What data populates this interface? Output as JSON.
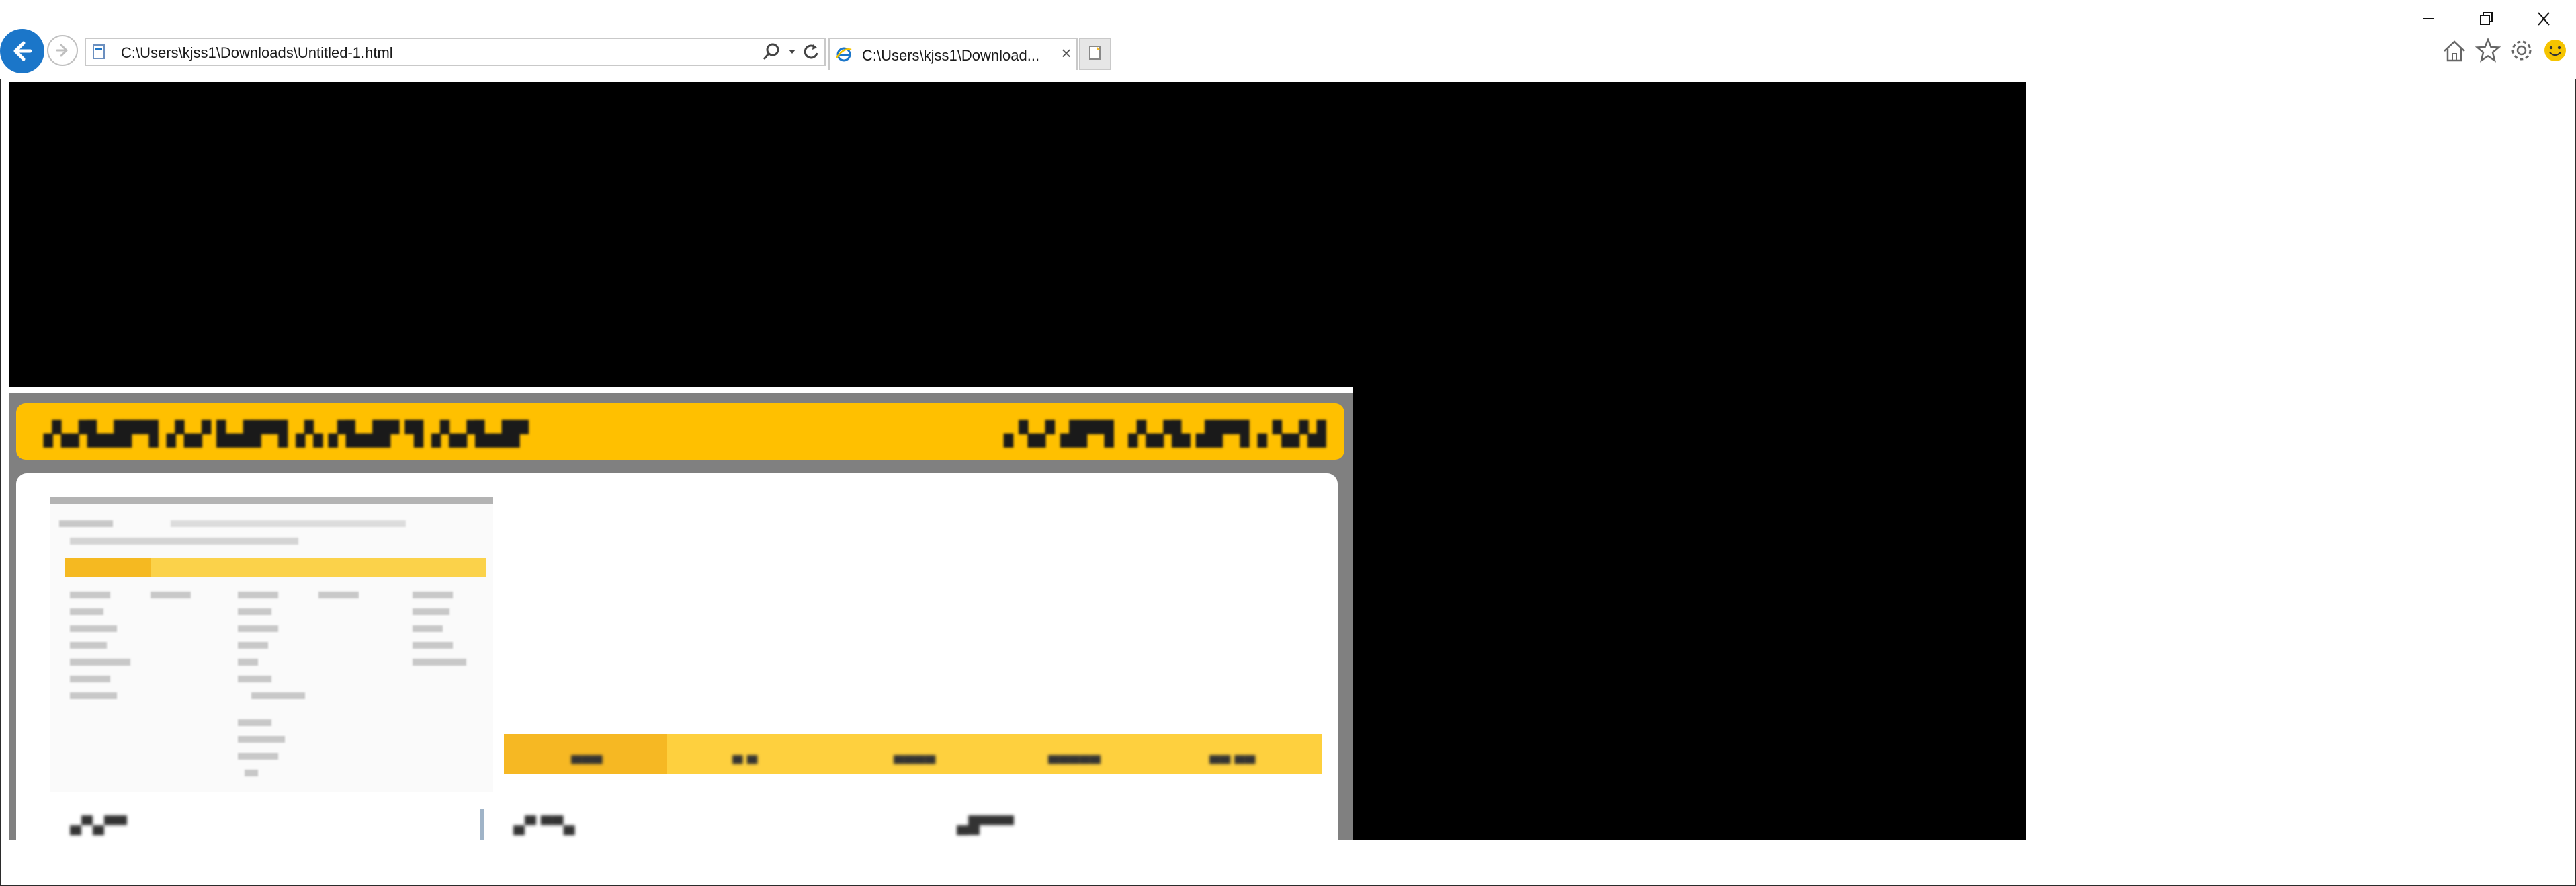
{
  "browser": {
    "address": "C:\\Users\\kjss1\\Downloads\\Untitled-1.html",
    "tab_title": "C:\\Users\\kjss1\\Download...",
    "tab_close": "×",
    "icons": {
      "back": "back-arrow-icon",
      "forward": "forward-arrow-icon",
      "search": "search-icon",
      "dropdown": "chevron-down-icon",
      "refresh": "refresh-icon",
      "home": "home-icon",
      "favorites": "star-icon",
      "settings": "gear-icon",
      "feedback": "smiley-icon"
    }
  },
  "page": {
    "banner": {
      "title": "▗▚▞▙▟▛▜▗▚▞ ▙▟▛▜▗▚ ▞▙▟▛ ▜▗▚▞▙▟▛",
      "right_text": "▗ ▚▞   ▟▛▜ ▗▚▞▙ ▟▛▜▗ ▚▞▟"
    },
    "menu": [
      "▄▄▄",
      "▄ ▄",
      "▄▄▄▄",
      "▄▄▄▄▄",
      "▄▄ ▄▄"
    ],
    "lower_items": [
      "▄▀▄▀▀",
      "▄▀ ▀▀▄",
      "▄█▀▀▀"
    ]
  },
  "colors": {
    "banner": "#ffc000",
    "menu": "#fed03e",
    "menu_active": "#f6b823",
    "back_button": "#1b76c9",
    "smiley": "#f5c400"
  }
}
